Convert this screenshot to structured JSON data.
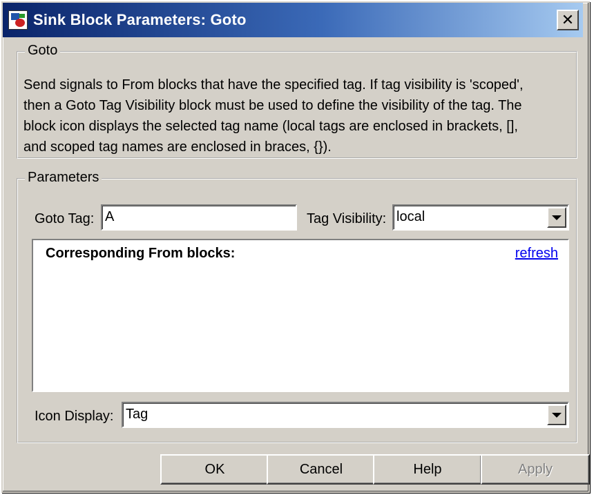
{
  "window": {
    "title": "Sink Block Parameters: Goto",
    "close_glyph": "✕"
  },
  "goto_group": {
    "legend": "Goto",
    "description_lines": [
      "Send signals to From blocks that have the specified tag.  If tag visibility is 'scoped',",
      "then a Goto Tag Visibility block must be used to define the visibility of the tag.  The",
      "block icon displays the selected tag name (local tags are enclosed in brackets, [],",
      "and scoped tag names are enclosed in braces, {})."
    ]
  },
  "parameters_group": {
    "legend": "Parameters",
    "goto_tag_label": "Goto Tag:",
    "goto_tag_value": "A",
    "tag_visibility_label": "Tag Visibility:",
    "tag_visibility_value": "local",
    "from_blocks_heading": "Corresponding From blocks:",
    "refresh_label": "refresh",
    "icon_display_label": "Icon Display:",
    "icon_display_value": "Tag"
  },
  "buttons": {
    "ok": "OK",
    "cancel": "Cancel",
    "help": "Help",
    "apply": "Apply"
  }
}
